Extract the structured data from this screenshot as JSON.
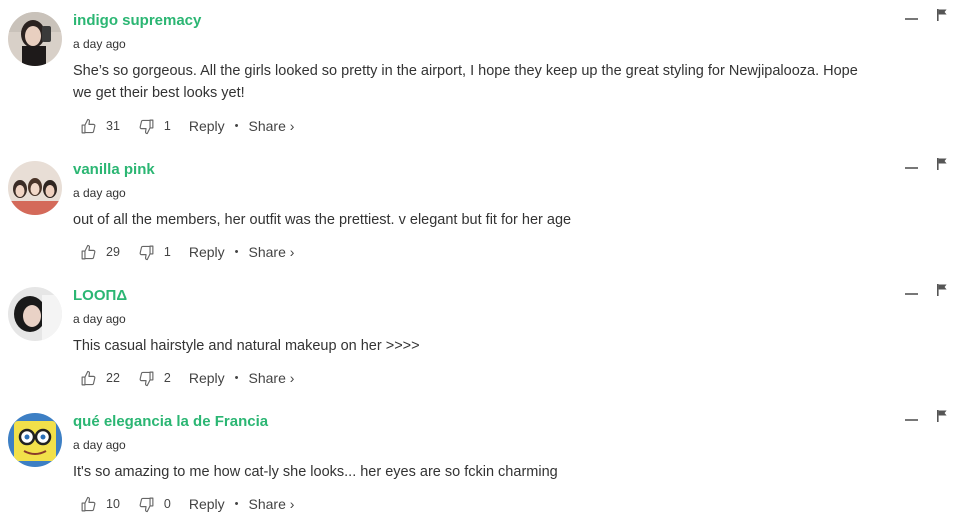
{
  "comments": [
    {
      "username": "indigo supremacy",
      "time": "a day ago",
      "text": "She’s so gorgeous. All the girls looked so pretty in the airport, I hope they keep up the great styling for Newjipalooza. Hope we get their best looks yet!",
      "likes": "31",
      "dislikes": "1",
      "reply_label": "Reply",
      "share_label": "Share ›",
      "separator": "•"
    },
    {
      "username": "vanilla pink",
      "time": "a day ago",
      "text": "out of all the members, her outfit was the prettiest. v elegant but fit for her age",
      "likes": "29",
      "dislikes": "1",
      "reply_label": "Reply",
      "share_label": "Share ›",
      "separator": "•"
    },
    {
      "username": "LOOΠΔ",
      "time": "a day ago",
      "text": "This casual hairstyle and natural makeup on her >>>>",
      "likes": "22",
      "dislikes": "2",
      "reply_label": "Reply",
      "share_label": "Share ›",
      "separator": "•"
    },
    {
      "username": "qué elegancia la de Francia",
      "time": "a day ago",
      "text": "It's so amazing to me how cat-ly she looks... her eyes are so fckin charming",
      "likes": "10",
      "dislikes": "0",
      "reply_label": "Reply",
      "share_label": "Share ›",
      "separator": "•"
    }
  ],
  "colors": {
    "username": "#2bb673",
    "text": "#333333",
    "icon": "#666666"
  },
  "icons": {
    "like": "thumbs-up-icon",
    "dislike": "thumbs-down-icon",
    "collapse": "minus-icon",
    "flag": "flag-icon"
  }
}
